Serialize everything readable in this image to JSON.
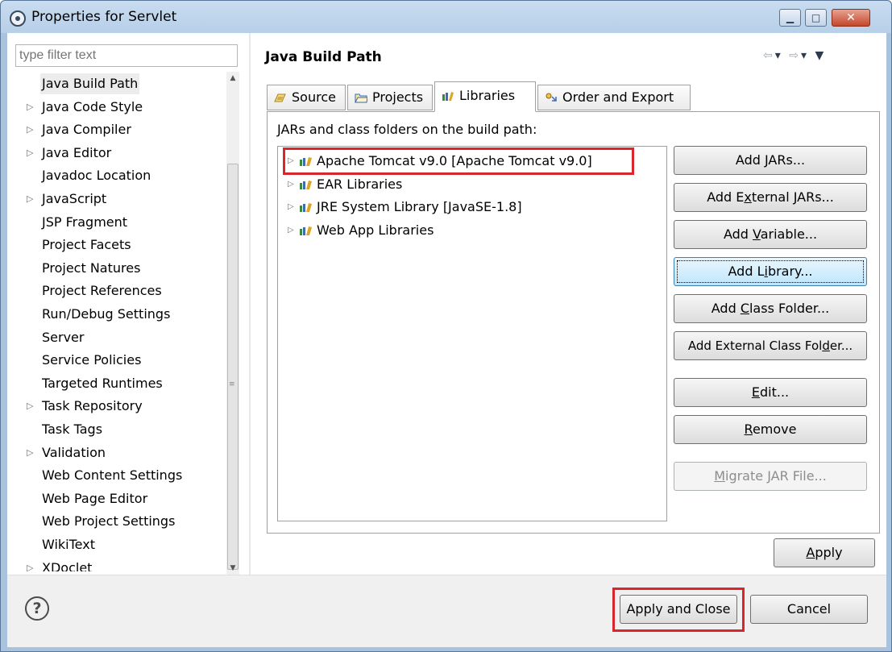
{
  "window": {
    "title": "Properties for Servlet",
    "minimize": "▁",
    "maximize": "□",
    "close": "✕"
  },
  "left": {
    "filter_placeholder": "type filter text",
    "items": [
      {
        "label": "Java Build Path",
        "expandable": false
      },
      {
        "label": "Java Code Style",
        "expandable": true
      },
      {
        "label": "Java Compiler",
        "expandable": true
      },
      {
        "label": "Java Editor",
        "expandable": true
      },
      {
        "label": "Javadoc Location",
        "expandable": false
      },
      {
        "label": "JavaScript",
        "expandable": true
      },
      {
        "label": "JSP Fragment",
        "expandable": false
      },
      {
        "label": "Project Facets",
        "expandable": false
      },
      {
        "label": "Project Natures",
        "expandable": false
      },
      {
        "label": "Project References",
        "expandable": false
      },
      {
        "label": "Run/Debug Settings",
        "expandable": false
      },
      {
        "label": "Server",
        "expandable": false
      },
      {
        "label": "Service Policies",
        "expandable": false
      },
      {
        "label": "Targeted Runtimes",
        "expandable": false
      },
      {
        "label": "Task Repository",
        "expandable": true
      },
      {
        "label": "Task Tags",
        "expandable": false
      },
      {
        "label": "Validation",
        "expandable": true
      },
      {
        "label": "Web Content Settings",
        "expandable": false
      },
      {
        "label": "Web Page Editor",
        "expandable": false
      },
      {
        "label": "Web Project Settings",
        "expandable": false
      },
      {
        "label": "WikiText",
        "expandable": false
      },
      {
        "label": "XDoclet",
        "expandable": true
      }
    ],
    "expand_glyph": "▷",
    "selected": "Java Build Path"
  },
  "right": {
    "title": "Java Build Path",
    "nav": {
      "back": "⇦",
      "forward": "⇨",
      "dropdown": "▾",
      "menu": "▼"
    },
    "tabs": [
      {
        "label": "Source",
        "icon": "source-icon"
      },
      {
        "label": "Projects",
        "icon": "folder-icon"
      },
      {
        "label": "Libraries",
        "icon": "library-icon"
      },
      {
        "label": "Order and Export",
        "icon": "order-export-icon"
      }
    ],
    "active_tab": "Libraries",
    "description": "JARs and class folders on the build path:",
    "libraries": [
      "Apache Tomcat v9.0 [Apache Tomcat v9.0]",
      "EAR Libraries",
      "JRE System Library [JavaSE-1.8]",
      "Web App Libraries"
    ],
    "buttons": {
      "add_jars": {
        "pre": "Add ",
        "u": "J",
        "post": "ARs..."
      },
      "add_external_jars": {
        "pre": "Add E",
        "u": "x",
        "post": "ternal JARs..."
      },
      "add_variable": {
        "pre": "Add ",
        "u": "V",
        "post": "ariable..."
      },
      "add_library": {
        "pre": "Add L",
        "u": "i",
        "post": "brary..."
      },
      "add_class_folder": {
        "pre": "Add ",
        "u": "C",
        "post": "lass Folder..."
      },
      "add_external_class_folder": {
        "pre": "Add External Class Fol",
        "u": "d",
        "post": "er..."
      },
      "edit": {
        "pre": "",
        "u": "E",
        "post": "dit..."
      },
      "remove": {
        "pre": "",
        "u": "R",
        "post": "emove"
      },
      "migrate_jar": {
        "pre": "",
        "u": "M",
        "post": "igrate JAR File..."
      }
    },
    "apply": {
      "pre": "",
      "u": "A",
      "post": "pply"
    }
  },
  "footer": {
    "help": "?",
    "apply_and_close": "Apply and Close",
    "cancel": "Cancel"
  },
  "colors": {
    "highlight_box": "#d9262c",
    "title_bar": "#b7cfe8"
  }
}
